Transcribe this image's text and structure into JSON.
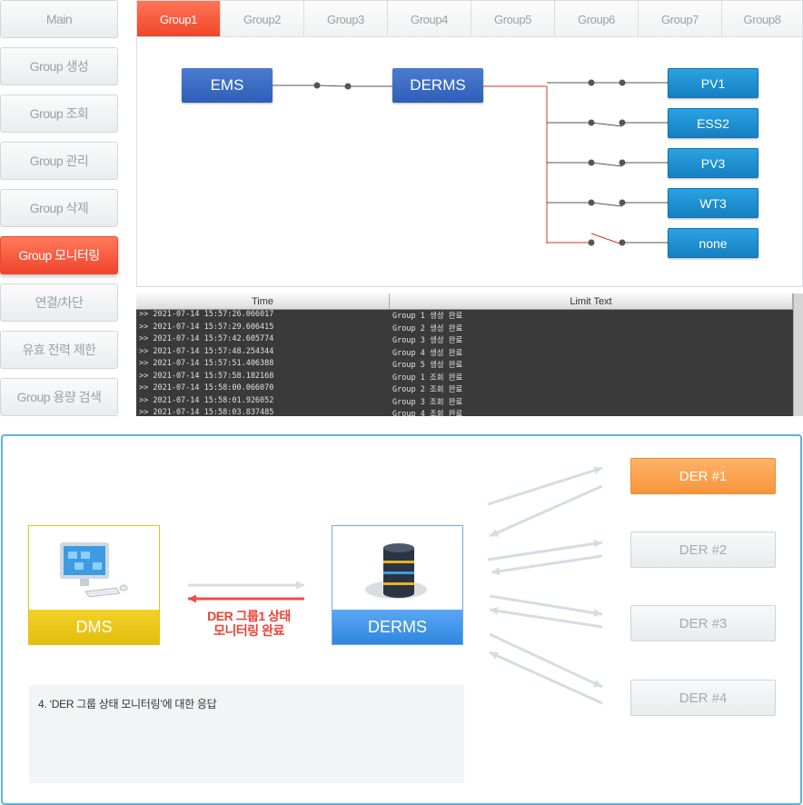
{
  "sidebar": {
    "items": [
      {
        "label": "Main"
      },
      {
        "label": "Group 생성"
      },
      {
        "label": "Group 조회"
      },
      {
        "label": "Group 관리"
      },
      {
        "label": "Group 삭제"
      },
      {
        "label": "Group 모니터링"
      },
      {
        "label": "연결/차단"
      },
      {
        "label": "유효 전력 제한"
      },
      {
        "label": "Group 용량 검색"
      }
    ],
    "active_index": 5
  },
  "tabs": [
    {
      "label": "Group1"
    },
    {
      "label": "Group2"
    },
    {
      "label": "Group3"
    },
    {
      "label": "Group4"
    },
    {
      "label": "Group5"
    },
    {
      "label": "Group6"
    },
    {
      "label": "Group7"
    },
    {
      "label": "Group8"
    }
  ],
  "diagram": {
    "ems": "EMS",
    "derms": "DERMS",
    "ders": [
      {
        "label": "PV1",
        "switch": "closed"
      },
      {
        "label": "ESS2",
        "switch": "closed"
      },
      {
        "label": "PV3",
        "switch": "closed"
      },
      {
        "label": "WT3",
        "switch": "closed"
      },
      {
        "label": "none",
        "switch": "open"
      }
    ]
  },
  "log": {
    "headers": [
      "Time",
      "Limit Text"
    ],
    "rows": [
      [
        ">> 2021-07-14 15:57:26.066017",
        "Group 1 생성 완료"
      ],
      [
        ">> 2021-07-14 15:57:29.606415",
        "Group 2 생성 완료"
      ],
      [
        ">> 2021-07-14 15:57:42.605774",
        "Group 3 생성 완료"
      ],
      [
        ">> 2021-07-14 15:57:48.254344",
        "Group 4 생성 완료"
      ],
      [
        ">> 2021-07-14 15:57:51.406388",
        "Group 5 생성 완료"
      ],
      [
        ">> 2021-07-14 15:57:58.182168",
        "Group 1 조회 완료"
      ],
      [
        ">> 2021-07-14 15:58:00.066070",
        "Group 2 조회 완료"
      ],
      [
        ">> 2021-07-14 15:58:01.926052",
        "Group 3 조회 완료"
      ],
      [
        ">> 2021-07-14 15:58:03.837485",
        "Group 4 조회 완료"
      ]
    ]
  },
  "flow": {
    "dms_label": "DMS",
    "derms_label": "DERMS",
    "caption_line1": "DER 그룹1 상태",
    "caption_line2": "모니터링 완료",
    "note": "4. ‘DER 그룹 상태 모니터링’에 대한 응답",
    "ders": [
      "DER #1",
      "DER #2",
      "DER #3",
      "DER #4"
    ],
    "active_der_index": 0
  },
  "colors": {
    "accent_red": "#f0442b",
    "node_blue": "#2f5fb6",
    "der_blue": "#157fc2",
    "dms_yellow": "#e8c516",
    "der_orange": "#f7953b",
    "panel_border": "#5cb1e6"
  }
}
